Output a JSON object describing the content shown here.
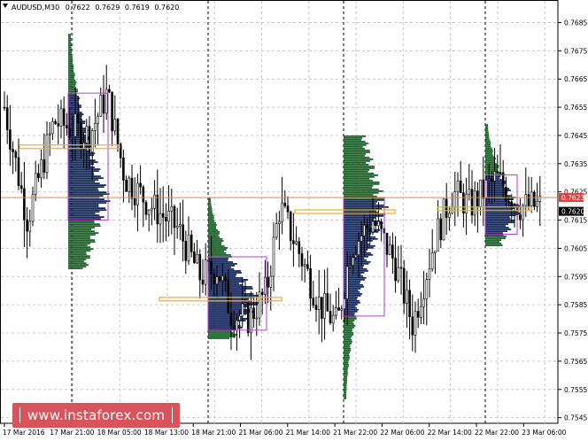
{
  "window": {
    "symbol_label": "AUDUSD,M30",
    "ohlc": {
      "open": "0.7622",
      "high": "0.7629",
      "low": "0.7619",
      "close": "0.7620"
    },
    "current_price": "0.7620",
    "marker_price": "0.7623",
    "watermark_text": "www.instaforex.com"
  },
  "colors": {
    "background": "#ffffff",
    "grid": "#c8c8c8",
    "session_separator": "#000000",
    "candle": "#000000",
    "profile_dark": "#0b1e5a",
    "profile_green": "#0e5c1e",
    "value_area_box": "#b040c8",
    "poc_line": "#f0b020",
    "price_line": "#f08040",
    "current_price_tag": "#000000",
    "marker_tag": "#e04040",
    "watermark": "#d8535a"
  },
  "chart_data": {
    "type": "candlestick",
    "symbol": "AUDUSD",
    "timeframe": "M30",
    "ylim": [
      0.7543,
      0.7693
    ],
    "y_ticks": [
      "0.7685",
      "0.7675",
      "0.7665",
      "0.7655",
      "0.7645",
      "0.7635",
      "0.7625",
      "0.7615",
      "0.7605",
      "0.7595",
      "0.7585",
      "0.7575",
      "0.7565",
      "0.7555",
      "0.7545"
    ],
    "x_ticks": [
      "17 Mar 2016",
      "17 Mar 21:00",
      "18 Mar 05:00",
      "18 Mar 13:00",
      "18 Mar 21:00",
      "21 Mar 06:00",
      "21 Mar 14:00",
      "21 Mar 22:00",
      "22 Mar 06:00",
      "22 Mar 14:00",
      "22 Mar 22:00",
      "23 Mar 06:00"
    ],
    "grid": true,
    "sessions": [
      {
        "label": "17 Mar",
        "poc": 0.7641,
        "value_area": [
          0.7615,
          0.766
        ]
      },
      {
        "label": "18 Mar",
        "poc": 0.7587,
        "value_area": [
          0.7576,
          0.7602
        ]
      },
      {
        "label": "21 Mar",
        "poc": 0.7618,
        "value_area": [
          0.7581,
          0.7623
        ]
      },
      {
        "label": "22 Mar",
        "poc": 0.7619,
        "value_area": [
          0.761,
          0.7631
        ]
      }
    ],
    "candles_overview": {
      "open_first": 0.7655,
      "close_last": 0.762,
      "high": 0.7681,
      "low": 0.755
    }
  }
}
